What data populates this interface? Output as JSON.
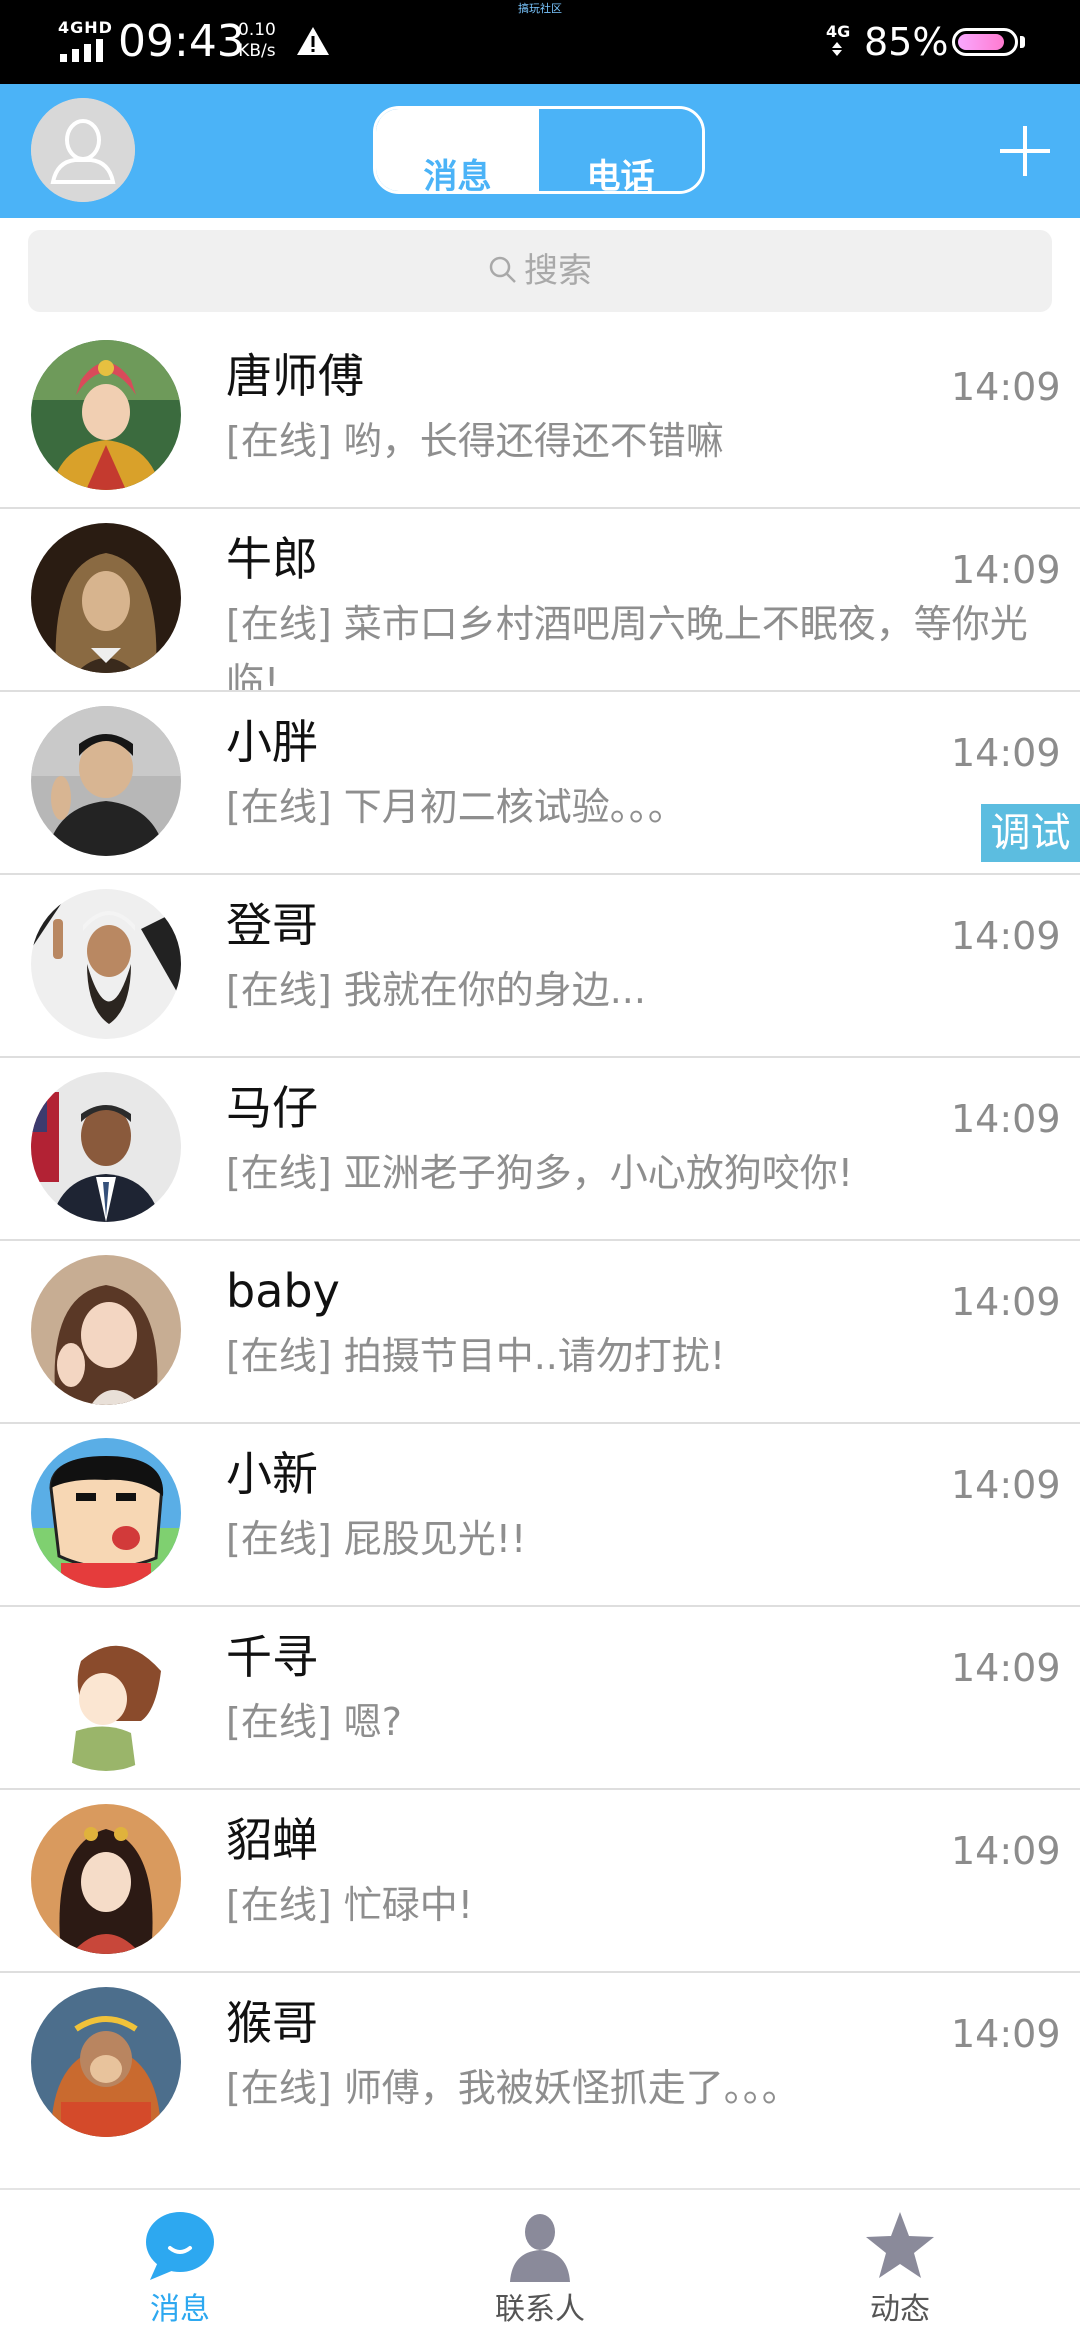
{
  "status_bar": {
    "network_type": "4GHD",
    "time": "09:43",
    "speed_value": "0.10",
    "speed_unit": "KB/s",
    "top_text": "搞玩社区",
    "mobile_data": "4G",
    "battery_percent": "85%",
    "battery_level": 0.85
  },
  "header": {
    "avatar_icon": "user-silhouette-icon",
    "tab_messages": "消息",
    "tab_calls": "电话",
    "active_tab": "消息",
    "add_icon": "plus-icon"
  },
  "search": {
    "placeholder": "搜索"
  },
  "conversations": [
    {
      "name": "唐师傅",
      "status": "[在线]",
      "message": "[在线] 哟，长得还得还不错嘛",
      "time": "14:09"
    },
    {
      "name": "牛郎",
      "status": "[在线]",
      "message": "[在线] 菜市口乡村酒吧周六晚上不眠夜，等你光临!",
      "time": "14:09"
    },
    {
      "name": "小胖",
      "status": "[在线]",
      "message": "[在线] 下月初二核试验。。。",
      "time": "14:09"
    },
    {
      "name": "登哥",
      "status": "[在线]",
      "message": "[在线] 我就在你的身边...",
      "time": "14:09"
    },
    {
      "name": "马仔",
      "status": "[在线]",
      "message": "[在线] 亚洲老子狗多，小心放狗咬你!",
      "time": "14:09"
    },
    {
      "name": "baby",
      "status": "[在线]",
      "message": "[在线] 拍摄节目中..请勿打扰!",
      "time": "14:09"
    },
    {
      "name": "小新",
      "status": "[在线]",
      "message": "[在线] 屁股见光!!",
      "time": "14:09"
    },
    {
      "name": "千寻",
      "status": "[在线]",
      "message": "[在线] 嗯?",
      "time": "14:09"
    },
    {
      "name": "貂蝉",
      "status": "[在线]",
      "message": "[在线] 忙碌中!",
      "time": "14:09"
    },
    {
      "name": "猴哥",
      "status": "[在线]",
      "message": "[在线] 师傅，我被妖怪抓走了。。。",
      "time": "14:09"
    }
  ],
  "debug_badge": "调试",
  "tabbar": {
    "messages": "消息",
    "contacts": "联系人",
    "moments": "动态",
    "active": "消息"
  },
  "colors": {
    "header_blue": "#4bb3f7",
    "active_tab": "#2da8f0",
    "inactive_tab": "#8a8a9a",
    "debug_badge": "#5cbde0"
  }
}
